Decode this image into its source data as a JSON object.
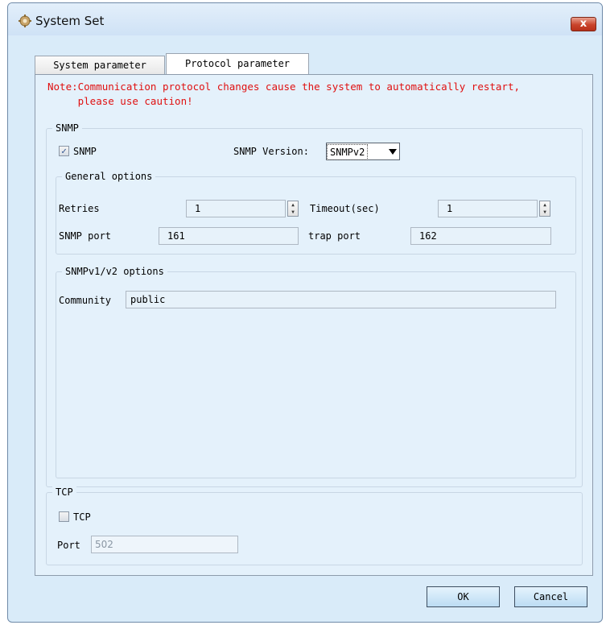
{
  "window": {
    "title": "System Set",
    "close_glyph": "x"
  },
  "tabs": [
    {
      "label": "System parameter",
      "active": false
    },
    {
      "label": "Protocol parameter",
      "active": true
    }
  ],
  "note": "Note:Communication protocol changes cause the system to automatically restart,\n     please use caution!",
  "snmp": {
    "group_title": "SNMP",
    "checkbox_label": "SNMP",
    "checked": true,
    "version_label": "SNMP Version:",
    "version_value": "SNMPv2",
    "general": {
      "title": "General options",
      "retries_label": "Retries",
      "retries_value": "1",
      "timeout_label": "Timeout(sec)",
      "timeout_value": "1",
      "port_label": "SNMP port",
      "port_value": "161",
      "trap_label": "trap port",
      "trap_value": "162"
    },
    "v1v2": {
      "title": "SNMPv1/v2 options",
      "community_label": "Community",
      "community_value": "public"
    }
  },
  "tcp": {
    "group_title": "TCP",
    "checkbox_label": "TCP",
    "checked": false,
    "port_label": "Port",
    "port_value": "502"
  },
  "buttons": {
    "ok": "OK",
    "cancel": "Cancel"
  },
  "colors": {
    "note": "#e01010",
    "window_bg": "#d9ebf9",
    "panel_bg": "#e4f1fb"
  }
}
